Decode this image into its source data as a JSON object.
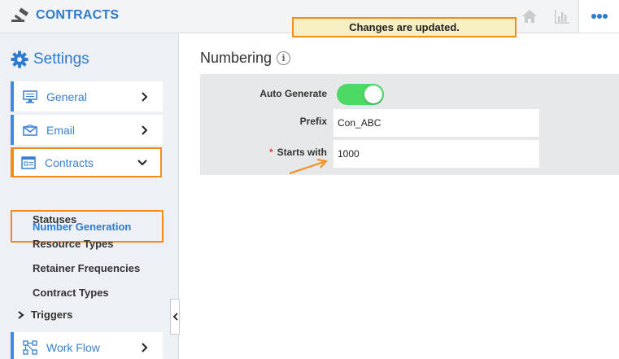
{
  "header": {
    "app_title": "CONTRACTS",
    "toast": "Changes are updated.",
    "icons": [
      "home-icon",
      "chart-icon",
      "more-icon"
    ]
  },
  "sidebar": {
    "title": "Settings",
    "items": [
      {
        "label": "General",
        "icon": "monitor-icon"
      },
      {
        "label": "Email",
        "icon": "envelope-icon"
      },
      {
        "label": "Contracts",
        "icon": "contract-icon"
      }
    ],
    "sub_items": [
      "Number Generation",
      "Statuses",
      "Resource Types",
      "Retainer Frequencies",
      "Contract Types"
    ],
    "triggers": "Triggers",
    "workflow": {
      "label": "Work Flow",
      "icon": "workflow-icon"
    }
  },
  "main": {
    "title": "Numbering",
    "auto_generate_label": "Auto Generate",
    "auto_generate_on": true,
    "prefix_label": "Prefix",
    "prefix_value": "Con_ABC",
    "starts_with_label": "Starts with",
    "starts_with_required": "*",
    "starts_with_value": "1000"
  },
  "colors": {
    "accent": "#2e7bcf",
    "highlight": "#f28c1b",
    "toggle_on": "#4cd964"
  }
}
